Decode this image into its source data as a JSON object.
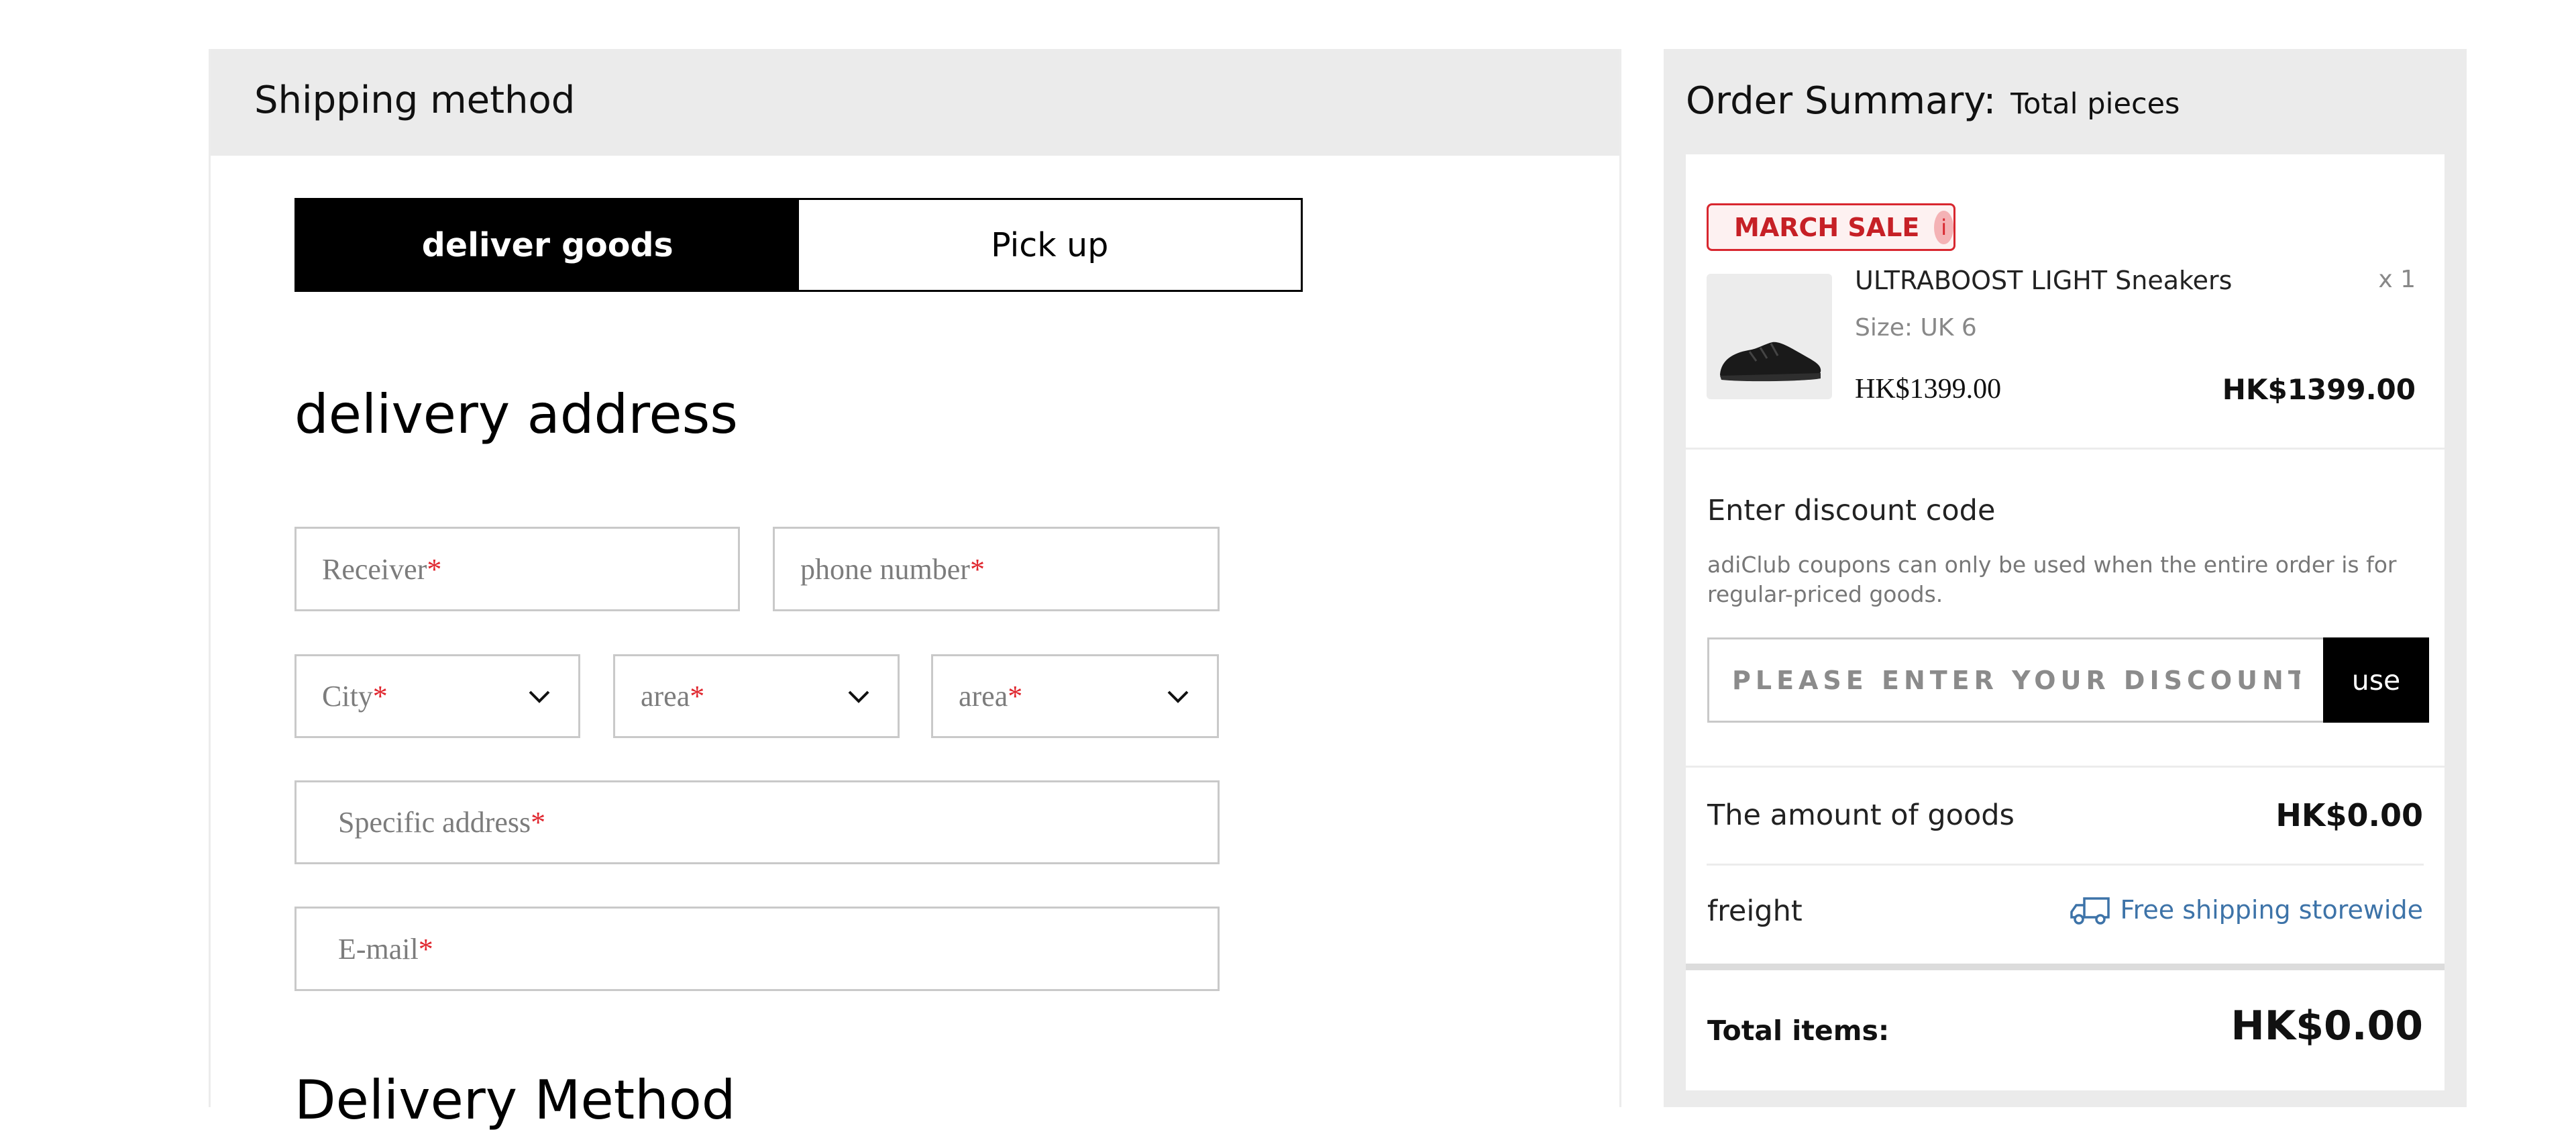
{
  "shipping": {
    "title": "Shipping method",
    "tabs": [
      {
        "label": "deliver goods",
        "active": true
      },
      {
        "label": "Pick up",
        "active": false
      }
    ],
    "address_heading": "delivery address",
    "fields": {
      "receiver": {
        "placeholder": "Receiver",
        "required_mark": "*"
      },
      "phone": {
        "placeholder": "phone number",
        "required_mark": "*"
      },
      "city": {
        "placeholder": "City",
        "required_mark": "*"
      },
      "area1": {
        "placeholder": "area",
        "required_mark": "*"
      },
      "area2": {
        "placeholder": "area",
        "required_mark": "*"
      },
      "specific_address": {
        "placeholder": "Specific address",
        "required_mark": "*"
      },
      "email": {
        "placeholder": "E-mail",
        "required_mark": "*"
      }
    },
    "method_heading": "Delivery Method"
  },
  "summary": {
    "title": "Order Summary:",
    "subtitle": "Total pieces",
    "badge": {
      "label": "MARCH SALE",
      "icon_glyph": "i"
    },
    "product": {
      "name": "ULTRABOOST LIGHT Sneakers",
      "quantity": "x 1",
      "size": "Size: UK 6",
      "unit_price": "HK$1399.00",
      "line_total": "HK$1399.00",
      "image_icon": "sneaker-image"
    },
    "discount": {
      "title": "Enter discount code",
      "note": "adiClub coupons can only be used when the entire order is for regular-priced goods.",
      "placeholder": "PLEASE ENTER YOUR DISCOUNT CODE",
      "button_label": "use"
    },
    "amount_label": "The amount of goods",
    "amount_value": "HK$0.00",
    "freight_label": "freight",
    "freight_value": "Free shipping storewide",
    "total_label": "Total items:",
    "total_value": "HK$0.00"
  },
  "colors": {
    "required": "#e0262e",
    "sale_red": "#d8272f",
    "link_blue": "#3d73a8",
    "panel_grey": "#ebebeb"
  }
}
